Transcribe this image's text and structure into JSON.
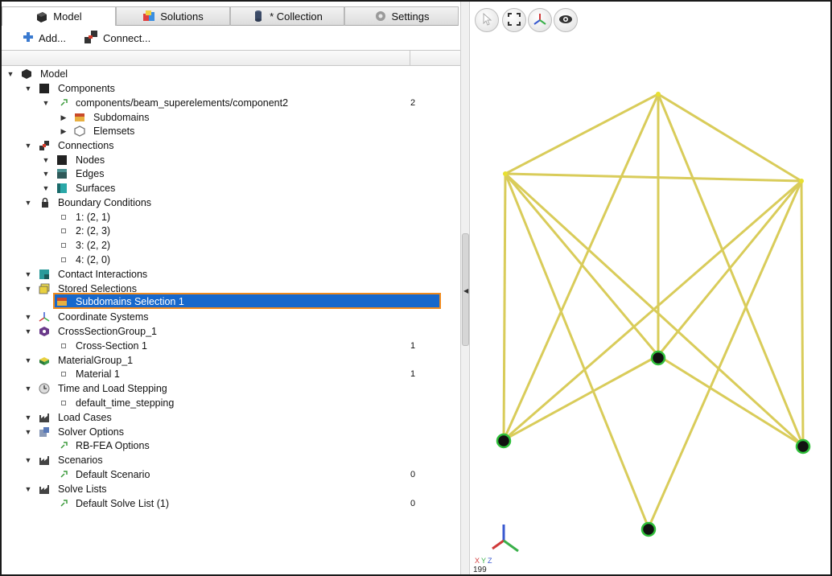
{
  "tabs": [
    {
      "label": "Model",
      "icon": "model-icon"
    },
    {
      "label": "Solutions",
      "icon": "solutions-icon"
    },
    {
      "label": "* Collection",
      "icon": "collection-icon"
    },
    {
      "label": "Settings",
      "icon": "settings-gear-icon"
    }
  ],
  "toolbar": {
    "add_label": "Add...",
    "connect_label": "Connect..."
  },
  "tree": {
    "model": "Model",
    "components": "Components",
    "component2": "components/beam_superelements/component2",
    "component2_value": "2",
    "subdomains": "Subdomains",
    "elemsets": "Elemsets",
    "connections": "Connections",
    "nodes": "Nodes",
    "edges": "Edges",
    "surfaces": "Surfaces",
    "boundary_conditions": "Boundary Conditions",
    "bc": [
      "1: (2, 1)",
      "2: (2, 3)",
      "3: (2, 2)",
      "4: (2, 0)"
    ],
    "contact_interactions": "Contact Interactions",
    "stored_selections": "Stored Selections",
    "subdomains_selection": "Subdomains Selection 1",
    "coordinate_systems": "Coordinate Systems",
    "cross_section_group": "CrossSectionGroup_1",
    "cross_section": "Cross-Section 1",
    "cross_section_value": "1",
    "material_group": "MaterialGroup_1",
    "material": "Material 1",
    "material_value": "1",
    "time_load": "Time and Load Stepping",
    "default_time": "default_time_stepping",
    "load_cases": "Load Cases",
    "solver_options": "Solver Options",
    "rb_fea": "RB-FEA Options",
    "scenarios": "Scenarios",
    "default_scenario": "Default Scenario",
    "default_scenario_value": "0",
    "solve_lists": "Solve Lists",
    "default_solve_list": "Default Solve List (1)",
    "default_solve_list_value": "0"
  },
  "viewport": {
    "tools": [
      "select-pointer-icon",
      "fit-view-icon",
      "axes-icon",
      "visibility-eye-icon"
    ],
    "axis_labels": {
      "x": "X",
      "y": "Y",
      "z": "Z"
    },
    "status_text": "199"
  },
  "colors": {
    "beam": "#d9cc5a",
    "node_ring": "#2fbf3a",
    "selection_fill": "#1768cc",
    "selection_border": "#f08a1c"
  }
}
